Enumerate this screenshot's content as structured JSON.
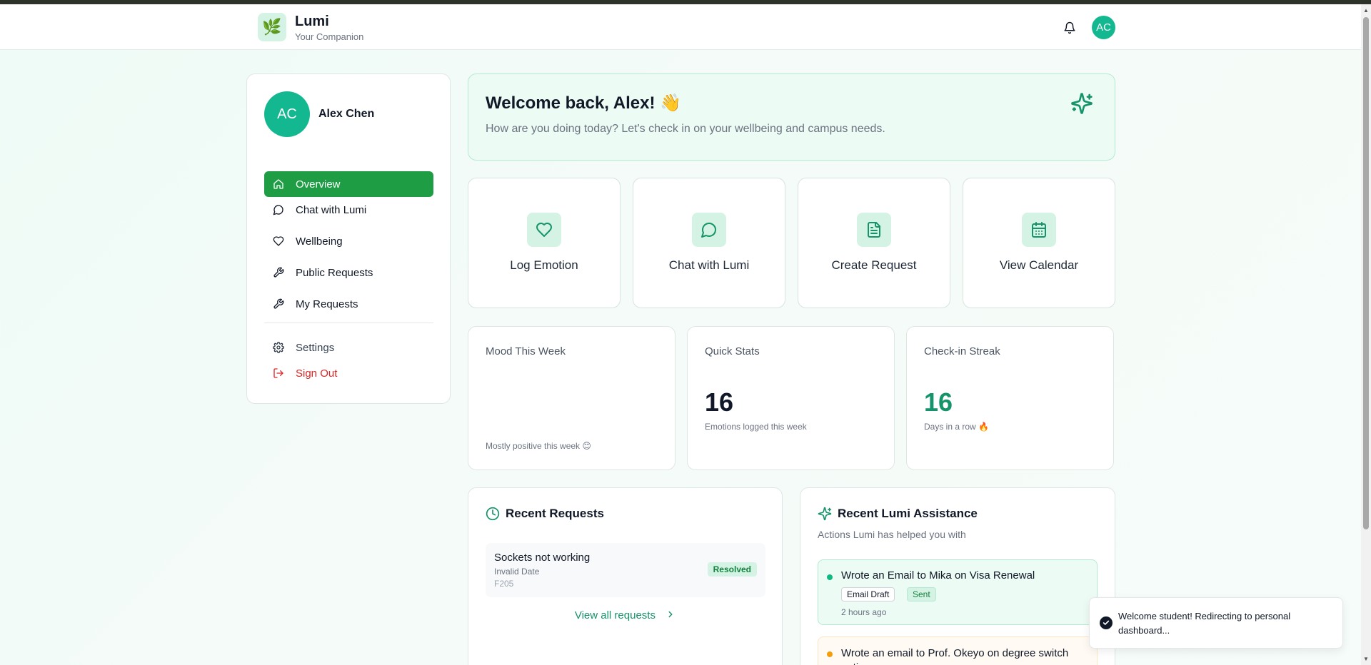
{
  "header": {
    "logo_emoji": "🌿",
    "app_title": "Lumi",
    "app_subtitle": "Your Companion",
    "avatar_initials": "AC"
  },
  "sidebar": {
    "avatar_initials": "AC",
    "user_name": "Alex Chen",
    "items": [
      {
        "label": "Overview",
        "icon": "home-icon",
        "active": true
      },
      {
        "label": "Chat with Lumi",
        "icon": "chat-bubble-icon"
      },
      {
        "label": "Wellbeing",
        "icon": "heart-icon"
      },
      {
        "label": "Public Requests",
        "icon": "wrench-icon"
      },
      {
        "label": "My Requests",
        "icon": "wrench-icon"
      }
    ],
    "settings_label": "Settings",
    "signout_label": "Sign Out"
  },
  "welcome": {
    "title": "Welcome back, Alex! 👋",
    "subtitle": "How are you doing today? Let's check in on your wellbeing and campus needs."
  },
  "actions": [
    {
      "label": "Log Emotion",
      "icon": "heart-icon"
    },
    {
      "label": "Chat with Lumi",
      "icon": "chat-bubble-icon"
    },
    {
      "label": "Create Request",
      "icon": "document-icon"
    },
    {
      "label": "View Calendar",
      "icon": "calendar-icon"
    }
  ],
  "stats": {
    "mood": {
      "title": "Mood This Week",
      "footer": "Mostly positive this week 😊"
    },
    "quick": {
      "title": "Quick Stats",
      "value": "16",
      "caption": "Emotions logged this week"
    },
    "streak": {
      "title": "Check-in Streak",
      "value": "16",
      "caption": "Days in a row 🔥"
    }
  },
  "recent_requests": {
    "title": "Recent Requests",
    "items": [
      {
        "title": "Sockets not working",
        "date": "Invalid Date",
        "location": "F205",
        "status": "Resolved"
      }
    ],
    "view_all": "View all requests"
  },
  "lumi_assistance": {
    "title": "Recent Lumi Assistance",
    "subtitle": "Actions Lumi has helped you with",
    "items": [
      {
        "title": "Wrote an Email to Mika on Visa Renewal",
        "tags": [
          "Email Draft",
          "Sent"
        ],
        "time": "2 hours ago",
        "dot_color": "#10b981"
      },
      {
        "title": "Wrote an email to Prof. Okeyo on degree switch options",
        "dot_color": "#f59e0b"
      }
    ]
  },
  "toast": {
    "message": "Welcome student! Redirecting to personal dashboard..."
  },
  "colors": {
    "primary": "#1f9d45",
    "accent": "#14b890",
    "accent_light": "#d5f3e4",
    "danger": "#dc2626"
  }
}
